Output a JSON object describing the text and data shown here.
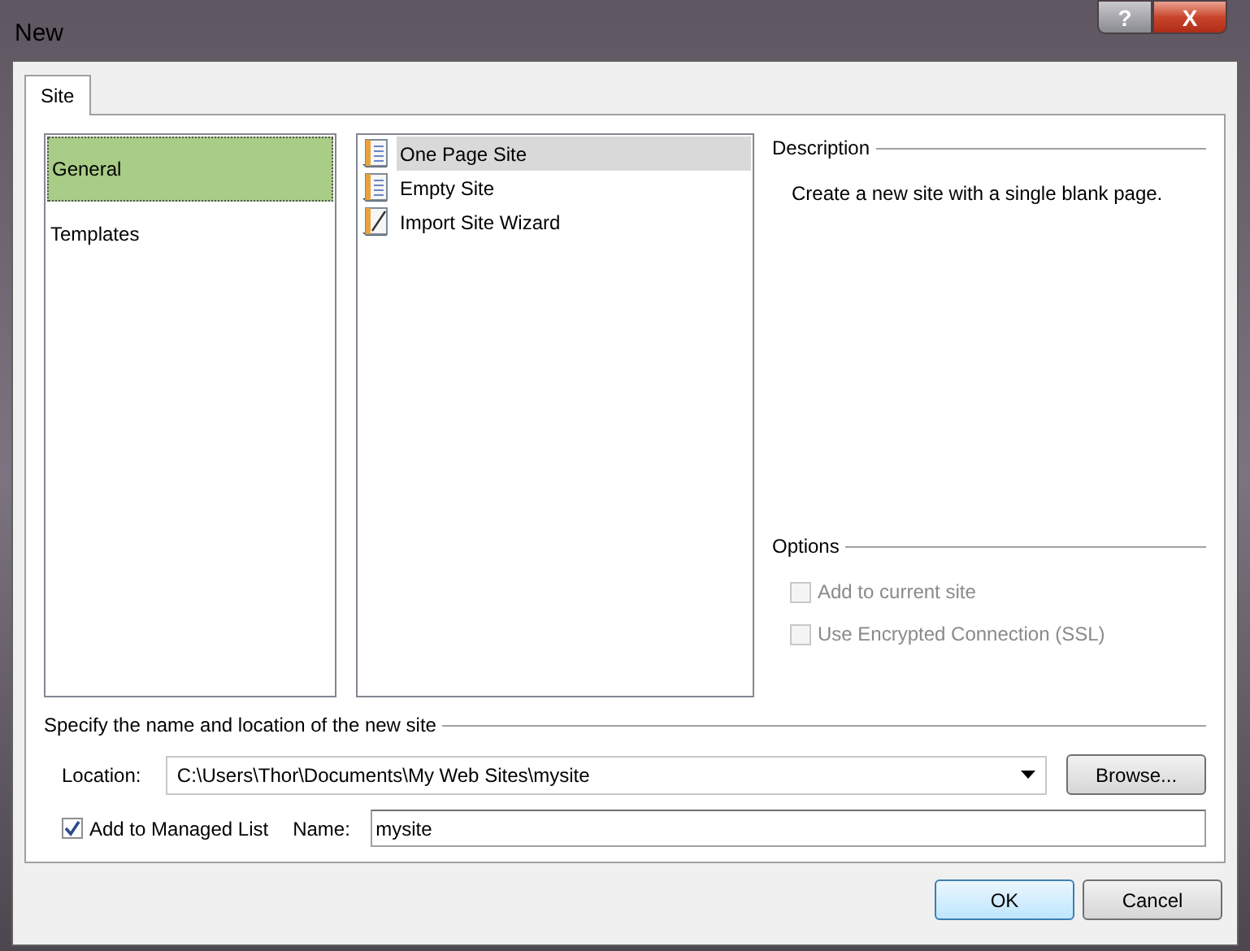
{
  "window": {
    "title": "New",
    "buttons": [
      {
        "kind": "help",
        "label": "?"
      },
      {
        "kind": "close",
        "label": "X"
      }
    ]
  },
  "tabs": [
    {
      "label": "Site",
      "selected": true
    }
  ],
  "categories": [
    {
      "label": "General",
      "selected": true
    },
    {
      "label": "Templates",
      "selected": false
    }
  ],
  "site_types": [
    {
      "label": "One Page Site",
      "selected": true,
      "kind": "page"
    },
    {
      "label": "Empty Site",
      "selected": false,
      "kind": "page"
    },
    {
      "label": "Import Site Wizard",
      "selected": false,
      "kind": "wizard"
    }
  ],
  "description": {
    "heading": "Description",
    "text": "Create a new site with a single blank page."
  },
  "options": {
    "heading": "Options",
    "items": [
      {
        "label": "Add to current site",
        "checked": false,
        "disabled": true
      },
      {
        "label": "Use Encrypted Connection (SSL)",
        "checked": false,
        "disabled": true
      }
    ]
  },
  "location_section": {
    "heading": "Specify the name and location of the new site",
    "location_label": "Location:",
    "location_value": "C:\\Users\\Thor\\Documents\\My Web Sites\\mysite",
    "browse": "Browse...",
    "managed": {
      "label": "Add to Managed List",
      "checked": true
    },
    "name_label": "Name:",
    "name_value": "mysite"
  },
  "buttons": [
    {
      "label": "OK",
      "kind": "default"
    },
    {
      "label": "Cancel",
      "kind": "normal"
    }
  ]
}
